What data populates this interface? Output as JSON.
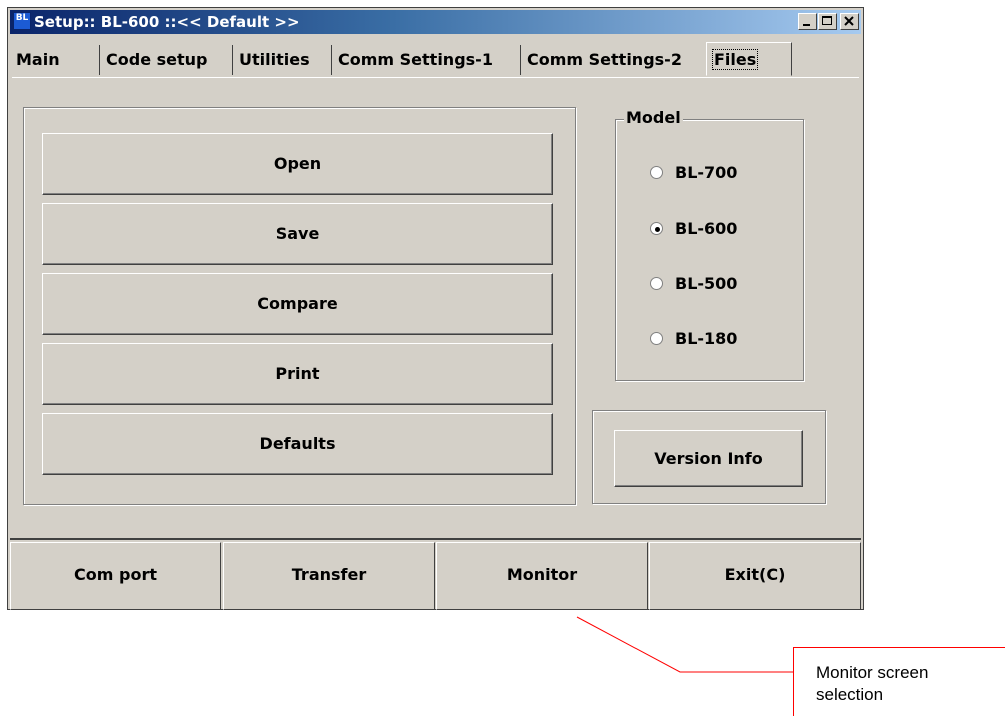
{
  "window": {
    "title": "Setup:: BL-600 ::<< Default >>",
    "app_icon_text": "BL",
    "minimize": "minimize",
    "maximize": "maximize",
    "close": "close"
  },
  "tabs": [
    {
      "label": "Main"
    },
    {
      "label": "Code setup"
    },
    {
      "label": "Utilities"
    },
    {
      "label": "Comm Settings-1"
    },
    {
      "label": "Comm Settings-2"
    },
    {
      "label": "Files",
      "active": true
    }
  ],
  "files": {
    "open_label": "Open",
    "save_label": "Save",
    "compare_label": "Compare",
    "print_label": "Print",
    "defaults_label": "Defaults"
  },
  "model": {
    "legend": "Model",
    "options": [
      "BL-700",
      "BL-600",
      "BL-500",
      "BL-180"
    ],
    "selected": "BL-600"
  },
  "version_label": "Version Info",
  "bottom_bar": {
    "com_port": "Com port",
    "transfer": "Transfer",
    "monitor": "Monitor",
    "exit": "Exit(C)"
  },
  "annotation": {
    "line1": "Monitor screen",
    "line2": "selection",
    "color": "#ff0000"
  }
}
